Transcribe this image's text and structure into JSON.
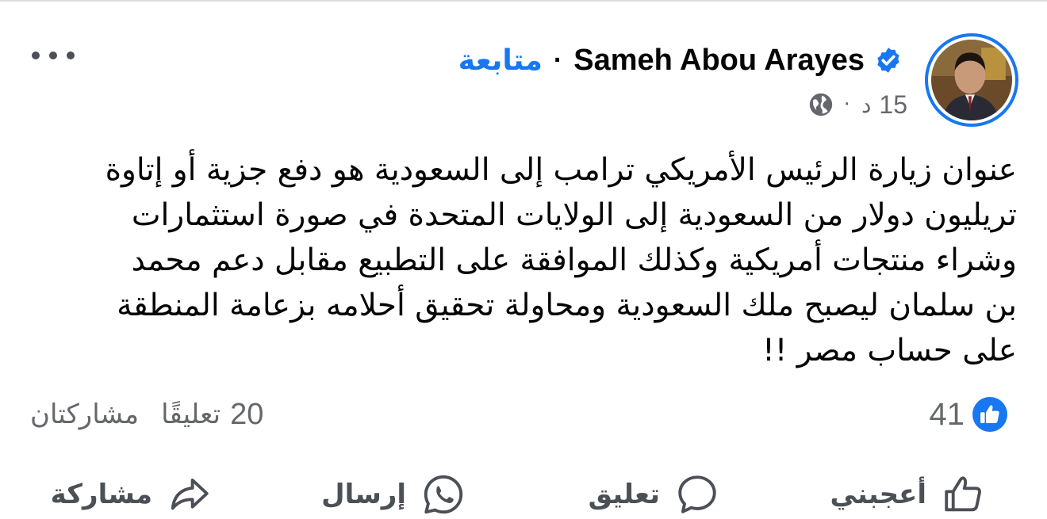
{
  "post": {
    "author": "Sameh Abou Arayes",
    "follow_label": "متابعة",
    "separator": "·",
    "time": "15",
    "time_unit": "د",
    "meta_dot": "·",
    "audience_icon": "globe-icon",
    "more_icon": "more-options-icon",
    "text_lines": [
      "عنوان زيارة الرئيس الأمريكي ترامب إلى السعودية هو دفع جزية أو إتاوة",
      "تريليون دولار من السعودية إلى الولايات المتحدة في صورة استثمارات",
      "وشراء منتجات أمريكية وكذلك الموافقة على التطبيع مقابل دعم محمد",
      "بن سلمان ليصبح ملك السعودية ومحاولة تحقيق أحلامه بزعامة المنطقة",
      "على حساب مصر !!"
    ]
  },
  "stats": {
    "likes": "41",
    "comments_num": "20",
    "comments_label": "تعليقًا",
    "shares_label": "مشاركتان"
  },
  "actions": {
    "like": "أعجبني",
    "comment": "تعليق",
    "send": "إرسال",
    "share": "مشاركة"
  },
  "colors": {
    "brand": "#1877f2",
    "secondary_text": "#65676b",
    "primary_text": "#050505"
  }
}
